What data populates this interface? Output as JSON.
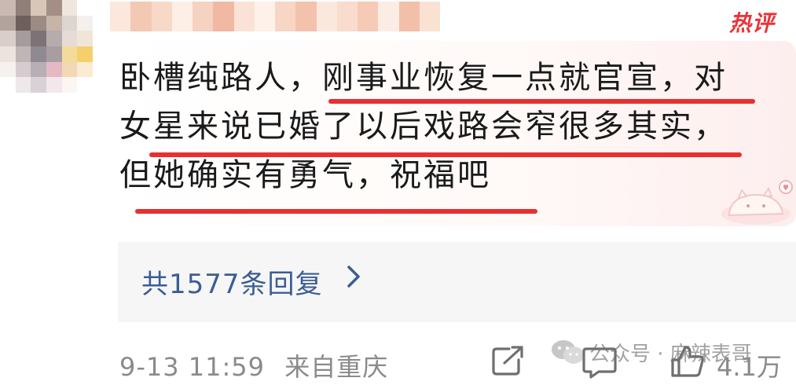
{
  "badge": {
    "label": "热评"
  },
  "comment": {
    "lines": [
      "卧槽纯路人，刚事业恢复一点就官宣，对",
      "女星来说已婚了以后戏路会窄很多其实，",
      "但她确实有勇气，祝福吧"
    ]
  },
  "replies": {
    "label": "共1577条回复"
  },
  "meta": {
    "timestamp": "9-13 11:59",
    "location": "来自重庆"
  },
  "actions": {
    "like_count": "4.1万"
  },
  "watermark": {
    "text": "公众号 · 麻辣表哥"
  },
  "icons": [
    "chevron-right-icon",
    "share-icon",
    "comment-icon",
    "like-icon"
  ],
  "colors": {
    "hot_badge": "#e8343a",
    "link": "#3b5d92",
    "underline": "#e83030",
    "meta": "#8a8a8a"
  }
}
